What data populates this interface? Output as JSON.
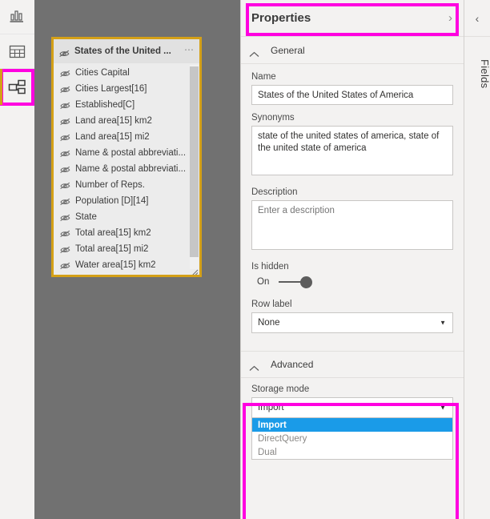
{
  "view_rail": {
    "items": [
      {
        "id": "report-view",
        "icon": "bar-chart-icon",
        "label": "Report",
        "selected": false
      },
      {
        "id": "data-view",
        "icon": "table-grid-icon",
        "label": "Data",
        "selected": false
      },
      {
        "id": "model-view",
        "icon": "model-relationship-icon",
        "label": "Model",
        "selected": true
      }
    ]
  },
  "canvas": {
    "table_card": {
      "title": "States of the United ...",
      "title_icon": "hidden-eye-icon",
      "menu_icon": "ellipsis-icon",
      "fields": [
        {
          "name": "Cities Capital",
          "icon": "hidden-eye-icon"
        },
        {
          "name": "Cities Largest[16]",
          "icon": "hidden-eye-icon"
        },
        {
          "name": "Established[C]",
          "icon": "hidden-eye-icon"
        },
        {
          "name": "Land area[15] km2",
          "icon": "hidden-eye-icon"
        },
        {
          "name": "Land area[15] mi2",
          "icon": "hidden-eye-icon"
        },
        {
          "name": "Name & postal abbreviati...",
          "icon": "hidden-eye-icon"
        },
        {
          "name": "Name & postal abbreviati...",
          "icon": "hidden-eye-icon"
        },
        {
          "name": "Number of Reps.",
          "icon": "hidden-eye-icon"
        },
        {
          "name": "Population [D][14]",
          "icon": "hidden-eye-icon"
        },
        {
          "name": "State",
          "icon": "hidden-eye-icon"
        },
        {
          "name": "Total area[15] km2",
          "icon": "hidden-eye-icon"
        },
        {
          "name": "Total area[15] mi2",
          "icon": "hidden-eye-icon"
        },
        {
          "name": "Water area[15] km2",
          "icon": "hidden-eye-icon"
        }
      ]
    }
  },
  "properties": {
    "title": "Properties",
    "expand_icon": "chevron-right-icon",
    "general": {
      "section_label": "General",
      "collapse_icon": "chevron-up-icon",
      "name_label": "Name",
      "name_value": "States of the United States of America",
      "synonyms_label": "Synonyms",
      "synonyms_value": "state of the united states of america, state of the united state of america",
      "description_label": "Description",
      "description_value": "",
      "description_placeholder": "Enter a description",
      "is_hidden_label": "Is hidden",
      "is_hidden_state": "On",
      "row_label_label": "Row label",
      "row_label_value": "None",
      "row_label_caret": "▼"
    },
    "advanced": {
      "section_label": "Advanced",
      "collapse_icon": "chevron-up-icon",
      "storage_mode_label": "Storage mode",
      "storage_mode_value": "Import",
      "storage_mode_caret": "▼",
      "options": [
        {
          "label": "Import",
          "selected": true
        },
        {
          "label": "DirectQuery",
          "selected": false
        },
        {
          "label": "Dual",
          "selected": false
        }
      ]
    }
  },
  "fields_rail": {
    "collapse_icon": "chevron-left-icon",
    "collapse_glyph": "‹",
    "label": "Fields"
  },
  "colors": {
    "canvas_background": "#717171",
    "highlight": "#ff00e0",
    "table_card_border": "#d4a017",
    "selection_blue": "#1a9be8",
    "panel_background": "#f3f2f1"
  }
}
